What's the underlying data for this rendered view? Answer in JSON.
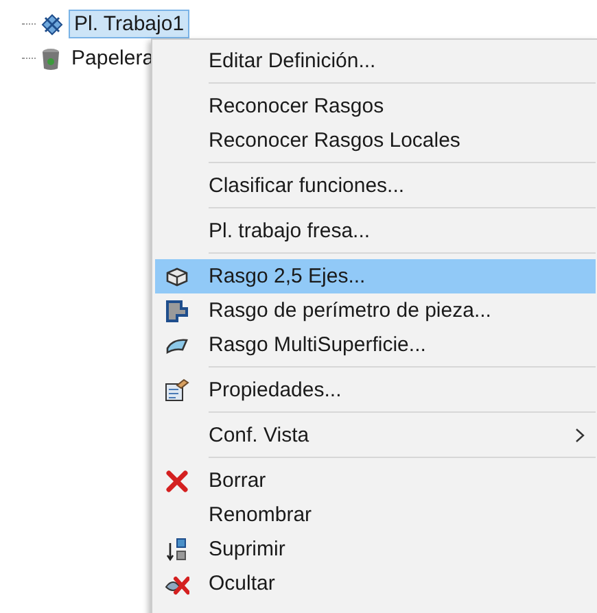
{
  "tree": {
    "items": [
      {
        "label": "Pl. Trabajo1",
        "selected": true
      },
      {
        "label": "Papelera",
        "selected": false
      }
    ]
  },
  "context_menu": {
    "sections": [
      {
        "items": [
          {
            "label": "Editar Definición...",
            "selected": false
          }
        ]
      },
      {
        "items": [
          {
            "label": "Reconocer Rasgos",
            "selected": false
          },
          {
            "label": "Reconocer Rasgos Locales",
            "selected": false
          }
        ]
      },
      {
        "items": [
          {
            "label": "Clasificar funciones...",
            "selected": false
          }
        ]
      },
      {
        "items": [
          {
            "label": "Pl. trabajo fresa...",
            "selected": false
          }
        ]
      },
      {
        "items": [
          {
            "label": "Rasgo 2,5 Ejes...",
            "selected": true
          },
          {
            "label": "Rasgo de perímetro de pieza...",
            "selected": false
          },
          {
            "label": "Rasgo MultiSuperficie...",
            "selected": false
          }
        ]
      },
      {
        "items": [
          {
            "label": "Propiedades...",
            "selected": false
          }
        ]
      },
      {
        "items": [
          {
            "label": "Conf. Vista",
            "selected": false,
            "submenu": true
          }
        ]
      },
      {
        "items": [
          {
            "label": "Borrar",
            "selected": false
          },
          {
            "label": "Renombrar",
            "selected": false
          },
          {
            "label": "Suprimir",
            "selected": false
          },
          {
            "label": "Ocultar",
            "selected": false
          }
        ]
      }
    ]
  }
}
